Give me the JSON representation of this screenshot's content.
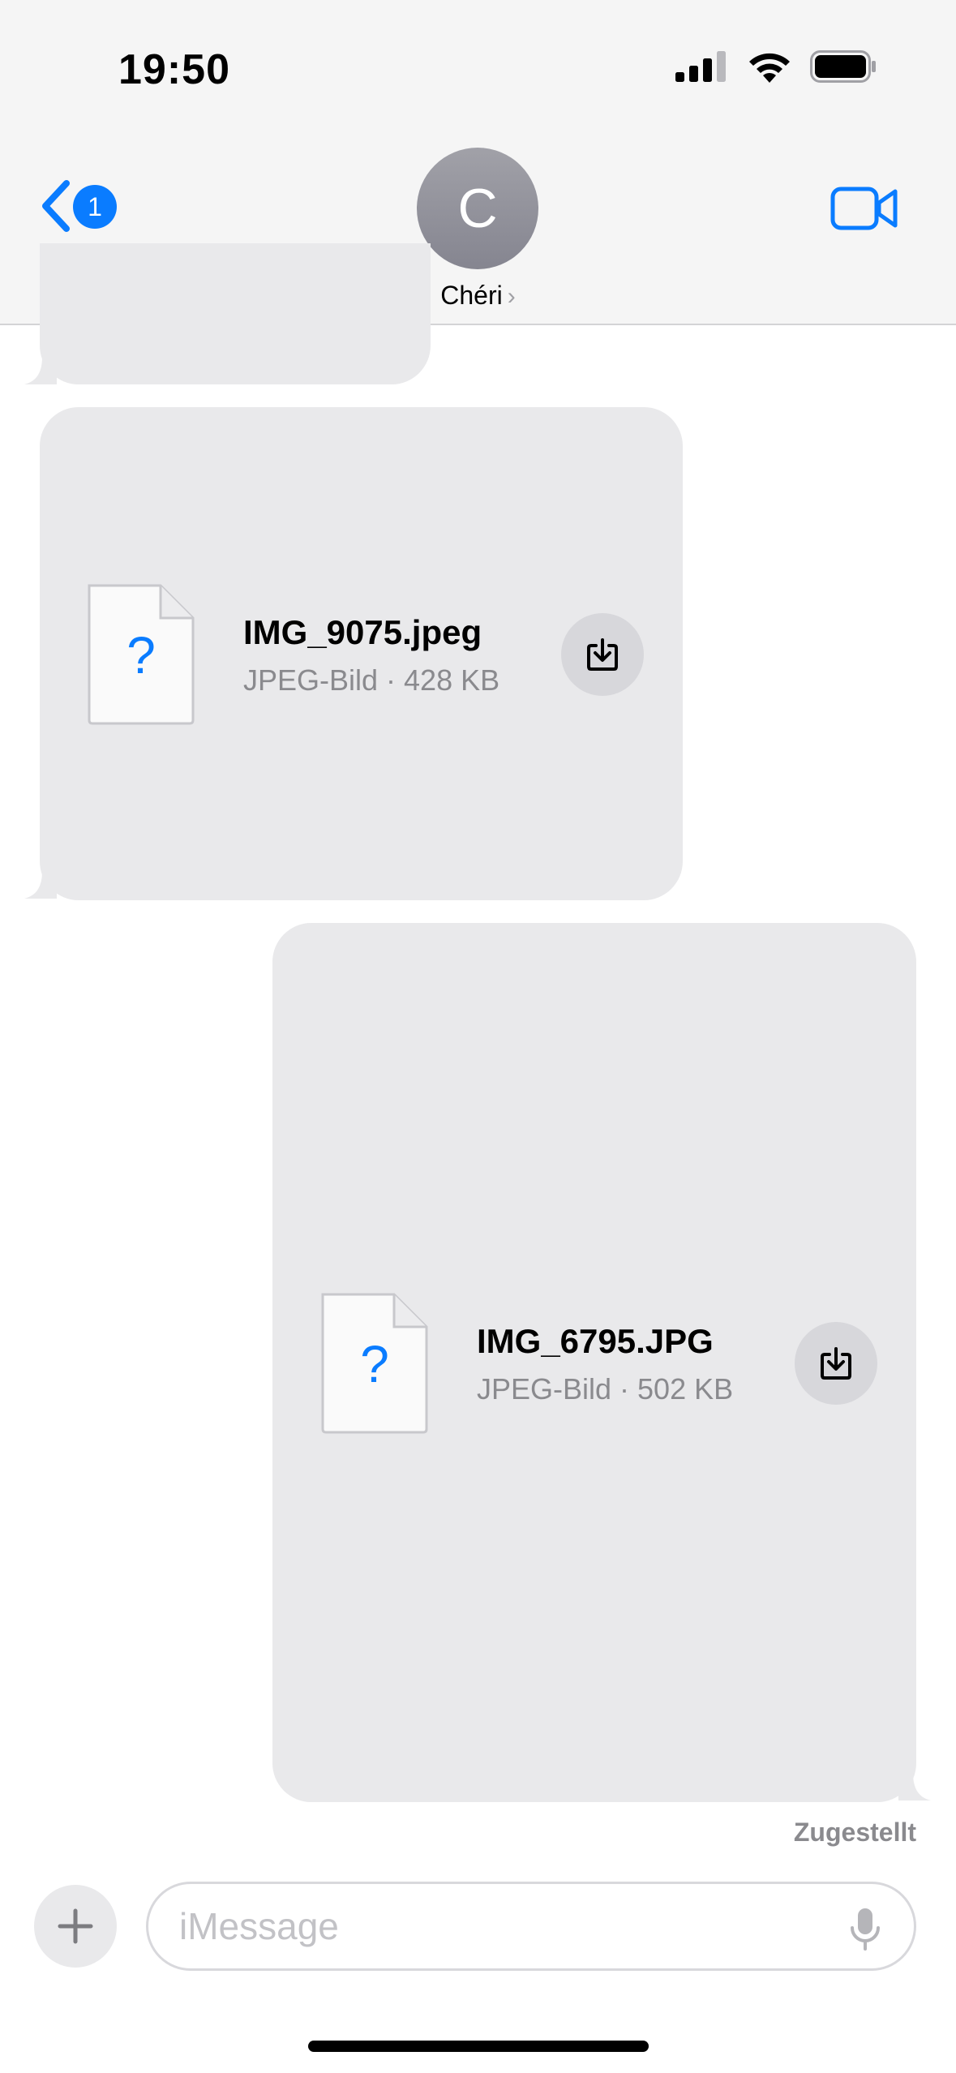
{
  "status_bar": {
    "time": "19:50",
    "icons": [
      "cellular-signal-icon",
      "wifi-icon",
      "battery-icon"
    ]
  },
  "header": {
    "back_badge_count": "1",
    "avatar_initial": "C",
    "contact_name": "Chéri",
    "contact_chevron": "›",
    "video_icon": "video-camera-icon",
    "accent_color": "#0a7cff"
  },
  "messages": [
    {
      "direction": "incoming",
      "file_name": "IMG_9075.jpeg",
      "file_meta": "JPEG-Bild · 428 KB",
      "doc_glyph": "?"
    },
    {
      "direction": "outgoing",
      "file_name": "IMG_6795.JPG",
      "file_meta": "JPEG-Bild · 502 KB",
      "doc_glyph": "?"
    }
  ],
  "delivery_status": "Zugestellt",
  "composer": {
    "placeholder": "iMessage",
    "value": ""
  },
  "colors": {
    "bubble_gray": "#e9e9eb",
    "header_bg": "#f5f5f5",
    "secondary_text": "#8a8a8e"
  }
}
